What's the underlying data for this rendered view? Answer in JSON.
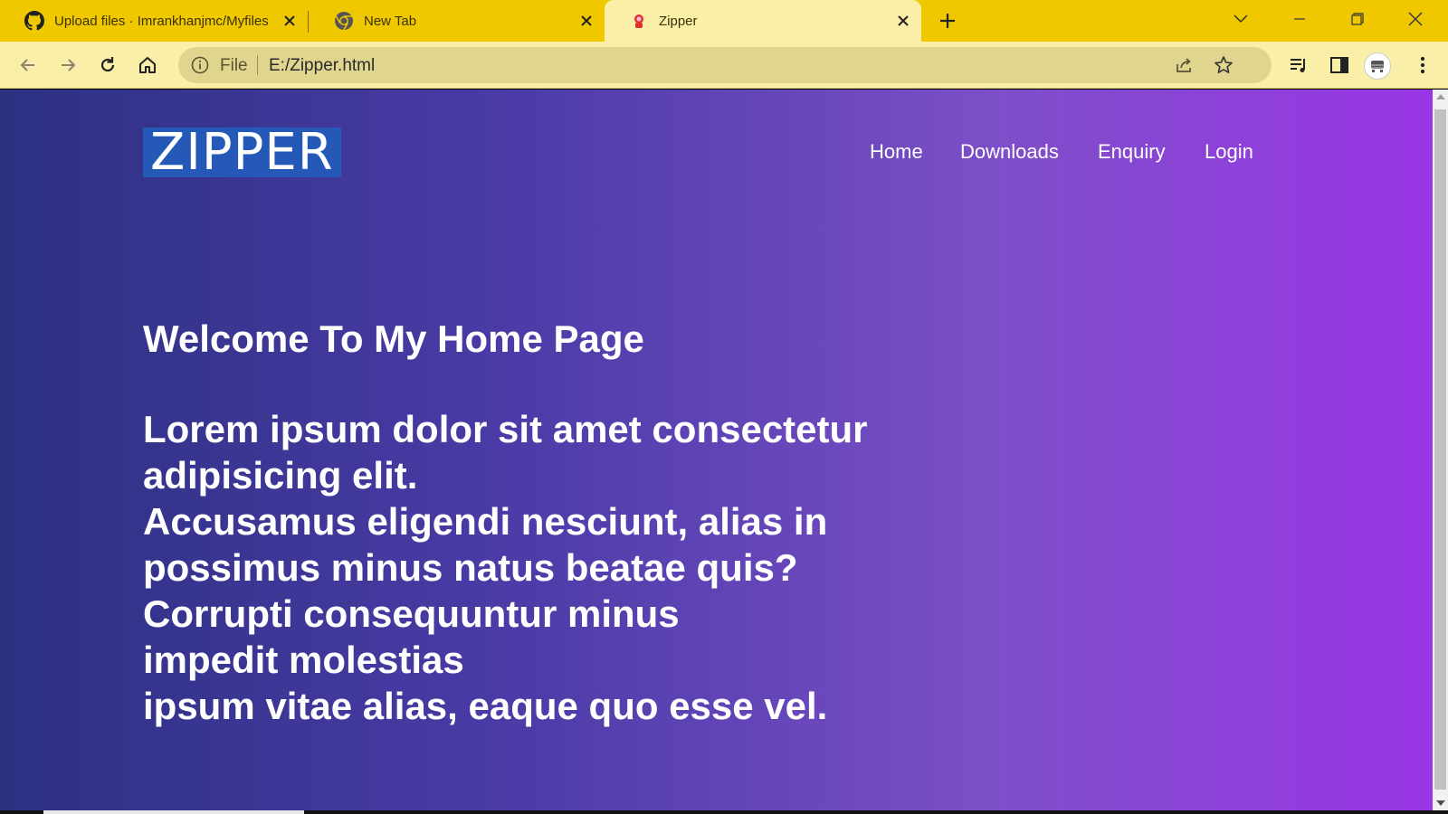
{
  "browser": {
    "tabs": [
      {
        "title": "Upload files · Imrankhanjmc/Myfiles",
        "icon": "github-icon",
        "active": false
      },
      {
        "title": "New Tab",
        "icon": "chrome-icon",
        "active": false
      },
      {
        "title": "Zipper",
        "icon": "site-favicon",
        "active": true
      }
    ],
    "address": {
      "scheme": "File",
      "url": "E:/Zipper.html"
    },
    "colors": {
      "frame": "#f0c800",
      "toolbar": "#f9efa8",
      "omnibox": "#dfd58f"
    }
  },
  "page": {
    "logo": "ZIPPER",
    "nav": [
      "Home",
      "Downloads",
      "Enquiry",
      "Login"
    ],
    "heading": "Welcome To My Home Page",
    "body_lines": [
      "Lorem ipsum dolor sit amet consectetur",
      "adipisicing elit.",
      "Accusamus eligendi nesciunt, alias in",
      "possimus minus natus beatae quis?",
      "Corrupti consequuntur minus",
      "impedit molestias",
      "ipsum vitae alias, eaque quo esse vel."
    ],
    "colors": {
      "gradient_start": "#2c3182",
      "gradient_end": "#9a35e6",
      "logo_bg": "#2559b7",
      "text": "#ffffff"
    }
  }
}
